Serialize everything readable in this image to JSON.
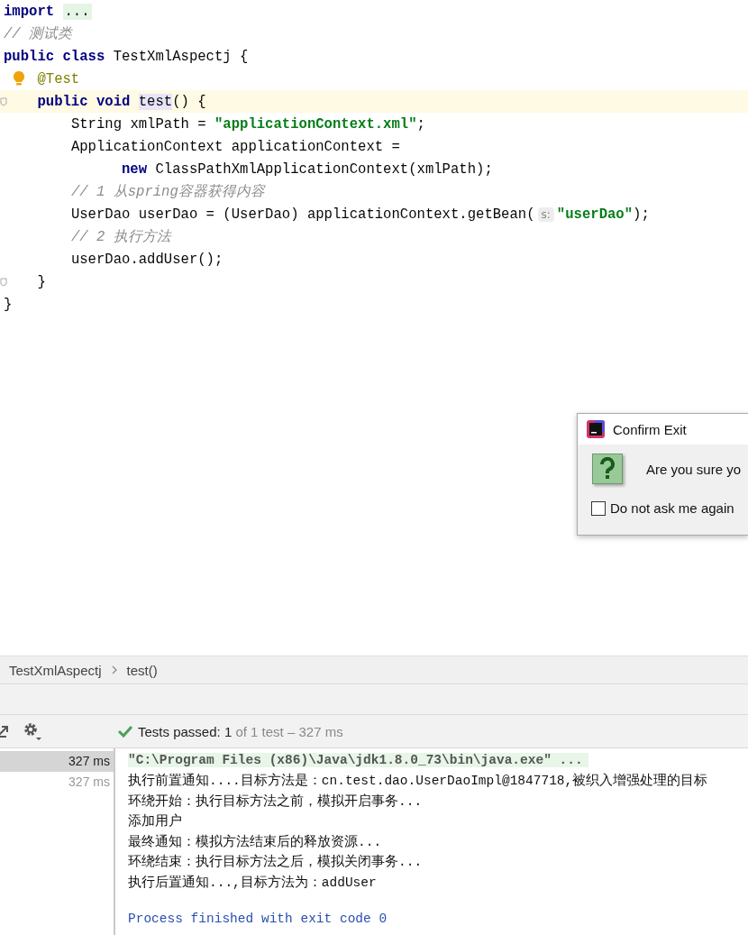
{
  "editor": {
    "lines": [
      {
        "current": false,
        "tokens": [
          {
            "kind": "keyword",
            "text": "import "
          },
          {
            "kind": "folded",
            "text": "..."
          }
        ]
      },
      {
        "current": false,
        "tokens": [
          {
            "kind": "comment",
            "text": "// 测试类"
          }
        ]
      },
      {
        "current": false,
        "tokens": [
          {
            "kind": "keyword",
            "text": "public class"
          },
          {
            "kind": "plain",
            "text": " TestXmlAspectj {"
          }
        ]
      },
      {
        "current": false,
        "gutter": {
          "kind": "bulb"
        },
        "tokens": [
          {
            "kind": "annotation",
            "text": "    @Test"
          }
        ]
      },
      {
        "current": true,
        "gutter": {
          "kind": "fold"
        },
        "tokens": [
          {
            "kind": "keyword",
            "text": "    public void "
          },
          {
            "kind": "usage",
            "text": "test"
          },
          {
            "kind": "plain",
            "text": "() {"
          }
        ]
      },
      {
        "current": false,
        "tokens": [
          {
            "kind": "plain",
            "text": "        String xmlPath = "
          },
          {
            "kind": "string",
            "text": "\"applicationContext.xml\""
          },
          {
            "kind": "plain",
            "text": ";"
          }
        ]
      },
      {
        "current": false,
        "tokens": [
          {
            "kind": "plain",
            "text": "        ApplicationContext applicationContext ="
          }
        ]
      },
      {
        "current": false,
        "tokens": [
          {
            "kind": "keyword",
            "text": "              new"
          },
          {
            "kind": "plain",
            "text": " ClassPathXmlApplicationContext(xmlPath);"
          }
        ]
      },
      {
        "current": false,
        "tokens": [
          {
            "kind": "comment",
            "text": "        // 1 从spring容器获得内容"
          }
        ]
      },
      {
        "current": false,
        "tokens": [
          {
            "kind": "plain",
            "text": "        UserDao userDao = (UserDao) applicationContext.getBean("
          },
          {
            "kind": "hint",
            "text": "s:"
          },
          {
            "kind": "string",
            "text": "\"userDao\""
          },
          {
            "kind": "plain",
            "text": ");"
          }
        ]
      },
      {
        "current": false,
        "tokens": [
          {
            "kind": "comment",
            "text": "        // 2 执行方法"
          }
        ]
      },
      {
        "current": false,
        "tokens": [
          {
            "kind": "plain",
            "text": "        userDao.addUser();"
          }
        ]
      },
      {
        "current": false,
        "gutter": {
          "kind": "fold"
        },
        "tokens": [
          {
            "kind": "plain",
            "text": "    }"
          }
        ]
      },
      {
        "current": false,
        "tokens": [
          {
            "kind": "plain",
            "text": "}"
          }
        ]
      }
    ]
  },
  "breadcrumbs": [
    {
      "label": "TestXmlAspectj"
    },
    {
      "label": "test()"
    }
  ],
  "test_status": {
    "passed": true,
    "label": "Tests passed:",
    "count": "1",
    "detail": "of 1 test – 327 ms"
  },
  "test_tree": [
    {
      "time": "327 ms",
      "selected": true
    },
    {
      "time": "327 ms",
      "selected": false
    }
  ],
  "console": [
    {
      "kind": "command",
      "text": "\"C:\\Program Files (x86)\\Java\\jdk1.8.0_73\\bin\\java.exe\" ..."
    },
    {
      "kind": "output",
      "text": "执行前置通知....目标方法是：cn.test.dao.UserDaoImpl@1847718,被织入增强处理的目标"
    },
    {
      "kind": "output",
      "text": "环绕开始：执行目标方法之前，模拟开启事务..."
    },
    {
      "kind": "output",
      "text": "添加用户"
    },
    {
      "kind": "output",
      "text": "最终通知：模拟方法结束后的释放资源..."
    },
    {
      "kind": "output",
      "text": "环绕结束：执行目标方法之后，模拟关闭事务..."
    },
    {
      "kind": "output",
      "text": "执行后置通知...,目标方法为：addUser"
    },
    {
      "kind": "exit",
      "text": "Process finished with exit code 0"
    }
  ],
  "dialog": {
    "title": "Confirm Exit",
    "message": "Are you sure yo",
    "checkbox": {
      "label": "Do not ask me again",
      "checked": false
    }
  }
}
